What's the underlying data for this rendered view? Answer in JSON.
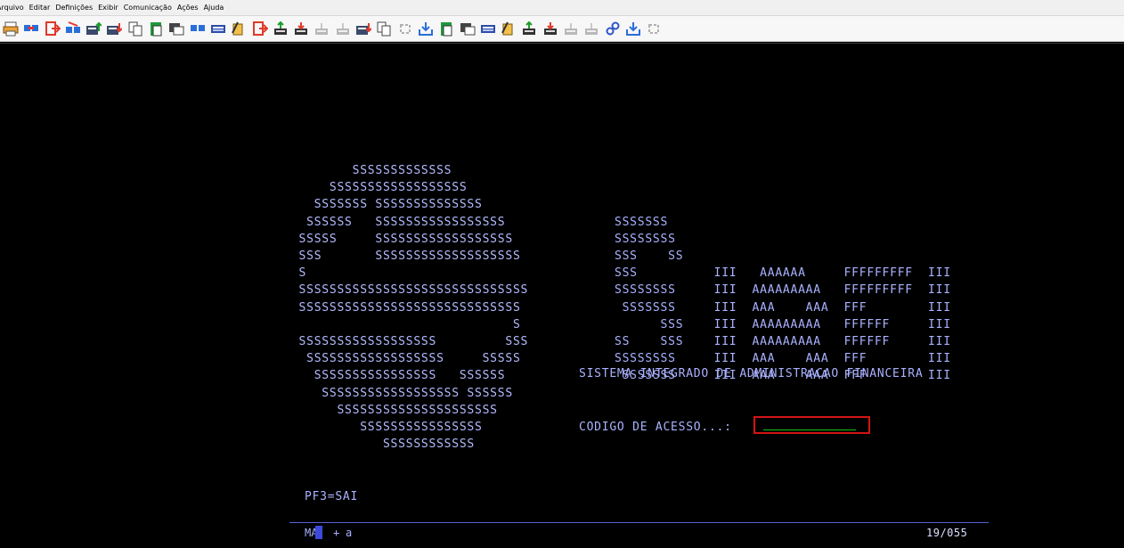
{
  "menu": [
    "Arquivo",
    "Editar",
    "Definições",
    "Exibir",
    "Comunicação",
    "Ações",
    "Ajuda"
  ],
  "toolbar_icons": [
    "printer-icon",
    "connect-icon",
    "exit-icon",
    "disconnect-icon",
    "send-file-icon",
    "receive-file-icon",
    "copy-icon",
    "paste-icon",
    "macro-icon",
    "session-icon",
    "keyboard-icon",
    "page-setup-icon",
    "quit-icon",
    "transfer-up-icon",
    "transfer-down-icon",
    "transfer-disabled-icon",
    "transfer-disabled-icon",
    "receive-file-icon",
    "copy-icon",
    "refresh-disabled-icon",
    "download-icon",
    "paste-icon",
    "macro-icon",
    "keyboard-icon",
    "page-setup-icon",
    "transfer-up-icon",
    "transfer-down-icon",
    "transfer-disabled-icon",
    "transfer-disabled-icon",
    "link-icon",
    "download-icon",
    "refresh-disabled-icon"
  ],
  "screen": {
    "logo_rows": [
      "             SSSSSSSSSSSSS",
      "          SSSSSSSSSSSSSSSSSS",
      "        SSSSSSS SSSSSSSSSSSSSS",
      "       SSSSSS   SSSSSSSSSSSSSSSSS",
      "      SSSSS     SSSSSSSSSSSSSSSSSS",
      "      SSS       SSSSSSSSSSSSSSSSSSS",
      "      S",
      "      SSSSSSSSSSSSSSSSSSSSSSSSSSSSSS",
      "      SSSSSSSSSSSSSSSSSSSSSSSSSSSSS",
      "                                  S",
      "      SSSSSSSSSSSSSSSSSS         SSS",
      "       SSSSSSSSSSSSSSSSSS     SSSSS",
      "        SSSSSSSSSSSSSSSS   SSSSSS",
      "         SSSSSSSSSSSSSSSSSS SSSSSS",
      "           SSSSSSSSSSSSSSSSSSSSS",
      "              SSSSSSSSSSSSSSSS",
      "                 SSSSSSSSSSSS"
    ],
    "siafi_rows": [
      "SSSSSSS",
      "SSSSSSSS",
      "SSS    SS",
      "SSS          III   AAAAAA     FFFFFFFFF  III",
      "SSSSSSSS     III  AAAAAAAAA   FFFFFFFFF  III",
      " SSSSSSS     III  AAA    AAA  FFF        III",
      "      SSS    III  AAAAAAAAA   FFFFFF     III",
      "SS    SSS    III  AAAAAAAAA   FFFFFF     III",
      "SSSSSSSS     III  AAA    AAA  FFF        III",
      " SSSSSSS     III  AAA    AAA  FFF        III"
    ],
    "system_title": "SISTEMA INTEGRADO DE ADMINISTRACAO FINANCEIRA",
    "access_label": "CODIGO DE ACESSO...:",
    "access_value": "",
    "pf_key": "PF3=SAI"
  },
  "oia": {
    "mode": "MA",
    "plus": "+",
    "flag": "a",
    "cursor_pos": "19/055"
  },
  "colors": {
    "background": "#000000",
    "text": "#aab2ff",
    "field_border": "#d41414",
    "field_underline": "#18c418",
    "status_line": "#5561d8"
  }
}
